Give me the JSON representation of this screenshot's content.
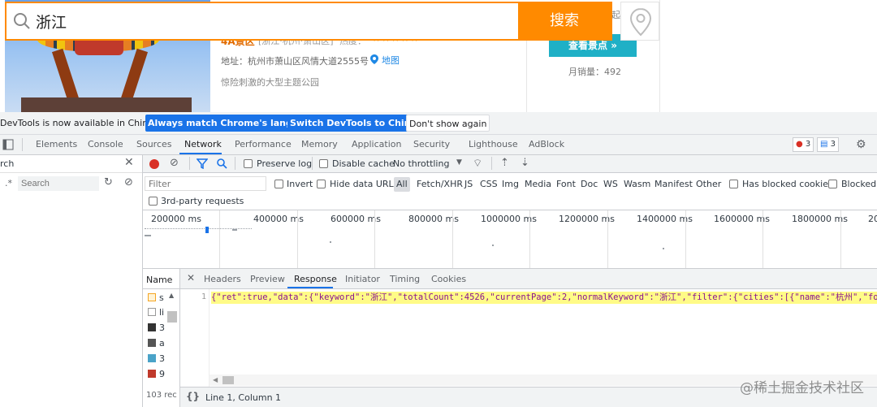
{
  "web": {
    "search_value": "浙江",
    "search_button": "搜索",
    "title_fragment": "4A景区",
    "subtitle_fragment": "[浙江·杭州·萧山区]",
    "rating_label": "热度：",
    "stars": "★★★★☆",
    "address": "地址：杭州市萧山区风情大道2555号",
    "map_link": "地图",
    "description": "惊险刺激的大型主题公园",
    "view_button": "查看景点 »",
    "monthly_sales": "月销量：492",
    "price_prefix": "起"
  },
  "infobar": {
    "message": "DevTools is now available in Chinese!",
    "btn_match": "Always match Chrome's language",
    "btn_switch": "Switch DevTools to Chinese",
    "btn_dont": "Don't show again"
  },
  "tabs": [
    "Elements",
    "Console",
    "Sources",
    "Network",
    "Performance",
    "Memory",
    "Application",
    "Security",
    "Lighthouse",
    "AdBlock"
  ],
  "badges": {
    "errors": "3",
    "messages": "3"
  },
  "left": {
    "search_label": "rch",
    "search_placeholder": "Search"
  },
  "toolbar": {
    "preserve_log": "Preserve log",
    "disable_cache": "Disable cache",
    "throttling": "No throttling"
  },
  "filter": {
    "placeholder": "Filter",
    "invert": "Invert",
    "hide_data_urls": "Hide data URLs",
    "all": "All",
    "types": [
      "Fetch/XHR",
      "JS",
      "CSS",
      "Img",
      "Media",
      "Font",
      "Doc",
      "WS",
      "Wasm",
      "Manifest",
      "Other"
    ],
    "has_blocked_cookies": "Has blocked cookies",
    "blocked": "Blocked R",
    "third_party": "3rd-party requests"
  },
  "overview": [
    "200000 ms",
    "400000 ms",
    "600000 ms",
    "800000 ms",
    "1000000 ms",
    "1200000 ms",
    "1400000 ms",
    "1600000 ms",
    "1800000 ms",
    "20"
  ],
  "requests": {
    "name_header": "Name",
    "rows": [
      "s",
      "li",
      "3",
      "a",
      "3",
      "9"
    ],
    "count": "103 rec"
  },
  "detail": {
    "tabs": [
      "Headers",
      "Preview",
      "Response",
      "Initiator",
      "Timing",
      "Cookies"
    ],
    "line_number": "1",
    "response": "{\"ret\":true,\"data\":{\"keyword\":\"浙江\",\"totalCount\":4526,\"currentPage\":2,\"normalKeyword\":\"浙江\",\"filter\":{\"cities\":[{\"name\":\"杭州\",\"foreign\":",
    "status": "Line 1, Column 1"
  },
  "watermark": "@稀土掘金技术社区",
  "colors": {
    "accent": "#ff8a00",
    "teal": "#1fb0c6",
    "devtools_blue": "#1a73e8"
  }
}
